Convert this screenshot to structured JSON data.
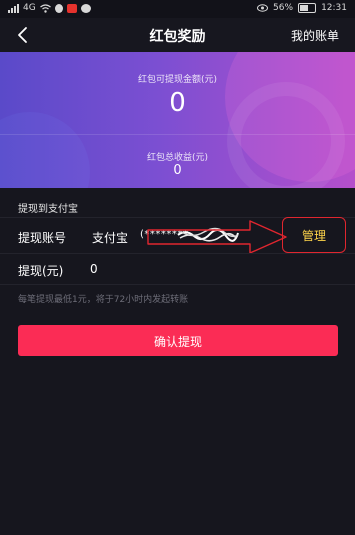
{
  "status_bar": {
    "signal_text": "4G",
    "battery_percent": "56%",
    "time": "12:31",
    "icons": [
      "signal-icon",
      "wifi-icon",
      "qq-icon",
      "app-notification-icon",
      "message-icon",
      "eye-icon",
      "battery-icon"
    ]
  },
  "nav": {
    "title": "红包奖励",
    "right_link": "我的账单",
    "back_icon": "chevron-left-icon"
  },
  "hero": {
    "withdrawable_label": "红包可提现金额(元)",
    "withdrawable_amount": "0",
    "total_label": "红包总收益(元)",
    "total_amount": "0"
  },
  "withdraw": {
    "section_title": "提现到支付宝",
    "account_label": "提现账号",
    "account_provider": "支付宝",
    "account_masked": "(********",
    "manage_label": "管理",
    "amount_label": "提现(元)",
    "amount_value": "0",
    "hint": "每笔提现最低1元，将于72小时内发起转账"
  },
  "actions": {
    "confirm_label": "确认提现"
  },
  "colors": {
    "accent": "#fb2c55",
    "manage_text": "#ffd54a",
    "annotation_red": "#e0262f",
    "hero_start": "#5a4ac9",
    "hero_end": "#b54fcb"
  }
}
